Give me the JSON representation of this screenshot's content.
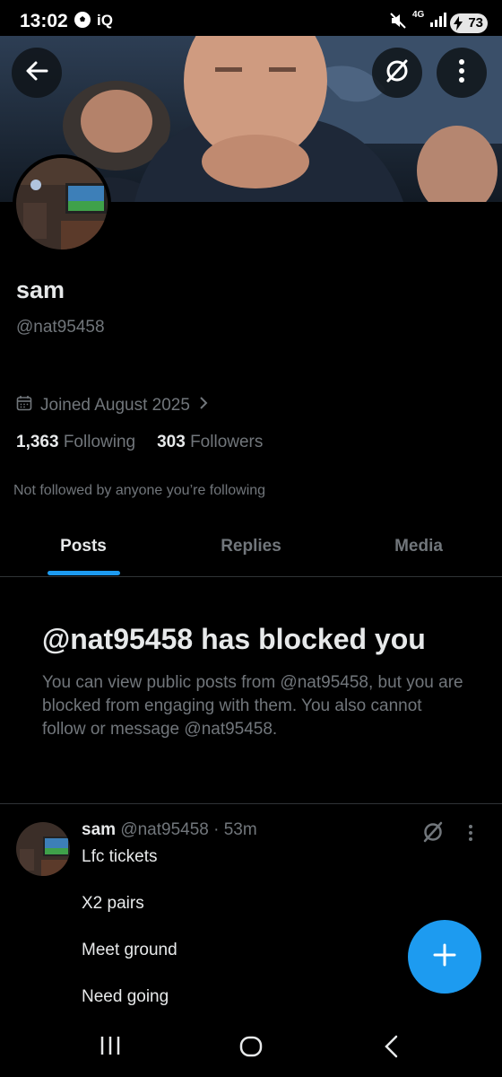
{
  "status_bar": {
    "time": "13:02",
    "carrier_label": "iQ",
    "network": "4G",
    "battery": "73"
  },
  "header": {
    "back_icon": "arrow-left-icon",
    "grok_icon": "grok-icon",
    "more_icon": "more-vertical-icon"
  },
  "profile": {
    "name": "sam",
    "handle": "@nat95458",
    "joined": "Joined August 2025",
    "following_count": "1,363",
    "following_label": "Following",
    "followers_count": "303",
    "followers_label": "Followers",
    "not_followed": "Not followed by anyone you’re following"
  },
  "tabs": [
    {
      "label": "Posts",
      "active": true
    },
    {
      "label": "Replies",
      "active": false
    },
    {
      "label": "Media",
      "active": false
    }
  ],
  "blocked": {
    "title": "@nat95458 has blocked you",
    "body": "You can view public posts from @nat95458, but you are blocked from engaging with them. You also cannot follow or message @nat95458."
  },
  "post": {
    "name": "sam",
    "meta": "@nat95458 · 53m",
    "lines": [
      "Lfc tickets",
      "X2 pairs",
      "Meet ground",
      "Need going"
    ]
  },
  "colors": {
    "accent": "#1d9bf0",
    "background": "#000000",
    "secondary_text": "#71767b",
    "primary_text": "#e7e9ea"
  }
}
